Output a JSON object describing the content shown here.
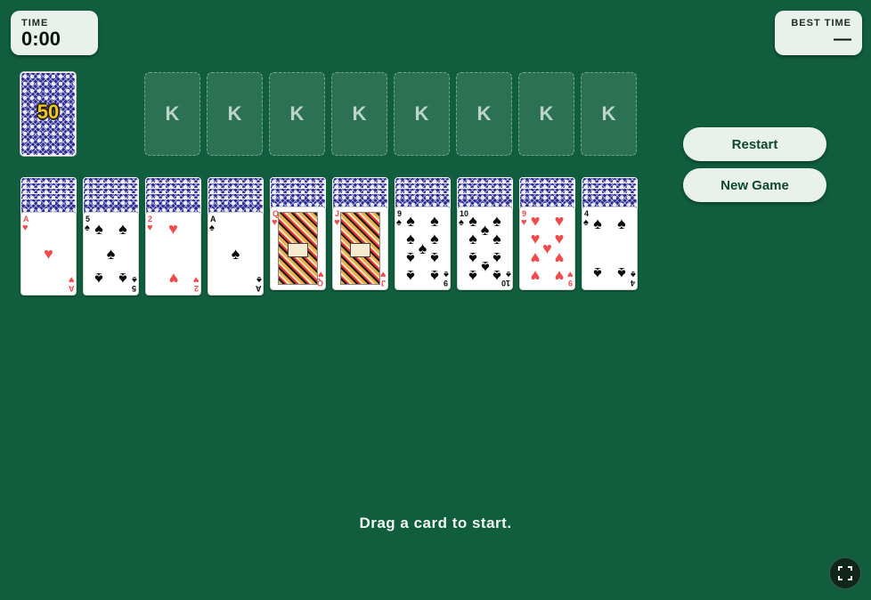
{
  "timer": {
    "label": "TIME",
    "value": "0:00"
  },
  "best_time": {
    "label": "BEST TIME",
    "value": "—"
  },
  "stock": {
    "count": "50"
  },
  "foundations": [
    "K",
    "K",
    "K",
    "K",
    "K",
    "K",
    "K",
    "K"
  ],
  "buttons": {
    "restart": "Restart",
    "new_game": "New Game"
  },
  "columns": [
    {
      "facedown": 5,
      "card": {
        "rank": "A",
        "suit": "♥",
        "color": "red"
      }
    },
    {
      "facedown": 5,
      "card": {
        "rank": "5",
        "suit": "♠",
        "color": "black"
      }
    },
    {
      "facedown": 5,
      "card": {
        "rank": "2",
        "suit": "♥",
        "color": "red"
      }
    },
    {
      "facedown": 5,
      "card": {
        "rank": "A",
        "suit": "♠",
        "color": "black"
      }
    },
    {
      "facedown": 4,
      "card": {
        "rank": "Q",
        "suit": "♥",
        "color": "red"
      }
    },
    {
      "facedown": 4,
      "card": {
        "rank": "J",
        "suit": "♥",
        "color": "red"
      }
    },
    {
      "facedown": 4,
      "card": {
        "rank": "9",
        "suit": "♠",
        "color": "black"
      }
    },
    {
      "facedown": 4,
      "card": {
        "rank": "10",
        "suit": "♠",
        "color": "black"
      }
    },
    {
      "facedown": 4,
      "card": {
        "rank": "9",
        "suit": "♥",
        "color": "red"
      }
    },
    {
      "facedown": 4,
      "card": {
        "rank": "4",
        "suit": "♠",
        "color": "black"
      }
    }
  ],
  "status_message": "Drag a card to start.",
  "icons": {
    "fullscreen": "fullscreen-icon"
  },
  "colors": {
    "felt": "#115e3e",
    "red_suit": "#f24a4a",
    "black_suit": "#0a0a0a",
    "button_bg": "#e9f1ec"
  }
}
